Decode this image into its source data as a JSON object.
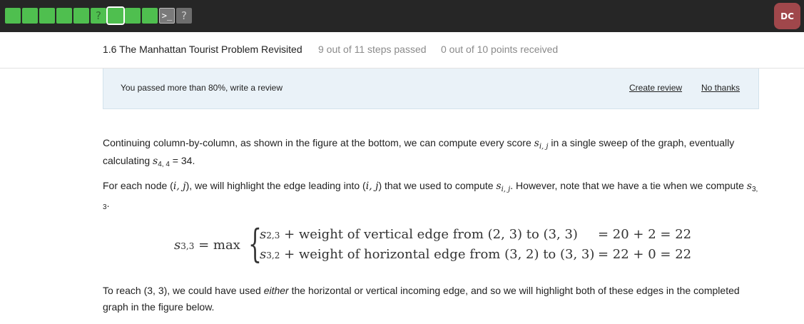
{
  "topbar": {
    "steps": [
      {
        "status": "passed",
        "glyph": ""
      },
      {
        "status": "passed",
        "glyph": ""
      },
      {
        "status": "passed",
        "glyph": ""
      },
      {
        "status": "passed",
        "glyph": ""
      },
      {
        "status": "passed",
        "glyph": ""
      },
      {
        "status": "passed",
        "glyph": "?"
      },
      {
        "status": "current",
        "glyph": ""
      },
      {
        "status": "passed",
        "glyph": ""
      },
      {
        "status": "passed",
        "glyph": ""
      },
      {
        "status": "code",
        "glyph": ">_"
      },
      {
        "status": "unvisited",
        "glyph": "?"
      }
    ],
    "avatar_initials": "DC",
    "colors": {
      "bar": "#262626",
      "passed": "#4fbf4f",
      "avatar": "#a0474b"
    }
  },
  "header": {
    "lesson_title": "1.6 The Manhattan Tourist Problem Revisited",
    "steps_passed": "9 out of 11 steps passed",
    "points": "0 out of 10 points  received"
  },
  "banner": {
    "text": "You passed more than 80%, write a review",
    "create_label": "Create review",
    "no_thanks_label": "No thanks"
  },
  "content": {
    "p1_a": "Continuing column-by-column, as shown in the figure at the bottom, we can compute every score ",
    "p1_var": "s",
    "p1_var_sub": "i, j",
    "p1_b": " in a single sweep of the graph, eventually calculating ",
    "p1_var2": "s",
    "p1_var2_sub": "4, 4",
    "p1_c": " = 34.",
    "p2_a": "For each node (",
    "p2_ij": "i, j",
    "p2_b": "), we will highlight the edge leading into (",
    "p2_ij2": "i, j",
    "p2_c": ") that we used to compute ",
    "p2_var": "s",
    "p2_var_sub": "i, j",
    "p2_d": ". However, note that we have a tie when we compute ",
    "p2_var2": "s",
    "p2_var2_sub": "3, 3",
    "p2_e": ".",
    "p3_a": "To reach (3, 3), we could have used ",
    "p3_em": "either",
    "p3_b": " the horizontal or vertical incoming edge, and so we will highlight both of these edges in the completed graph in the figure below."
  },
  "formula": {
    "lhs_var": "s",
    "lhs_sub": "3,3",
    "lhs_op": " = max",
    "row1_var": "s",
    "row1_sub": "2,3",
    "row1_text": " + weight of vertical edge from (2, 3) to (3, 3)",
    "row1_rhs": "= 20 + 2 = 22",
    "row2_var": "s",
    "row2_sub": "3,2",
    "row2_text": " + weight of horizontal edge from (3, 2) to (3, 3)",
    "row2_rhs": "= 22 + 0 = 22"
  }
}
